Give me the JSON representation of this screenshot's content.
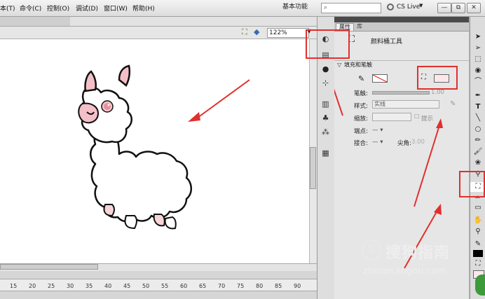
{
  "menu": {
    "items": [
      "本(T)",
      "命令(C)",
      "控制(O)",
      "调试(D)",
      "窗口(W)",
      "帮助(H)"
    ],
    "workspace": "基本功能",
    "cs_live": "CS Live"
  },
  "window_controls": [
    "—",
    "⧉",
    "✕"
  ],
  "stage": {
    "zoom": "122%"
  },
  "timeline": {
    "ruler_ticks": [
      "15",
      "20",
      "25",
      "30",
      "35",
      "40",
      "45",
      "50",
      "55",
      "60",
      "65",
      "70",
      "75",
      "80",
      "85",
      "90"
    ]
  },
  "properties": {
    "tabs": [
      "属性",
      "库"
    ],
    "tool_name": "颜料桶工具",
    "section": "填充和笔触",
    "stroke_label": "笔触:",
    "stroke_value": "1.00",
    "style_label": "样式:",
    "style_value": "实线",
    "scale_label": "缩放:",
    "hint_label": "提示",
    "cap_label": "端点:",
    "join_label": "接合:",
    "miter_label": "尖角:",
    "miter_value": "3.00"
  },
  "watermark": {
    "text": "搜狗指南",
    "url": "zhinan.sogou.com"
  },
  "colors": {
    "fill": "#fce8ea",
    "annotation": "#e0302e",
    "blush": "#f4c0c8"
  }
}
